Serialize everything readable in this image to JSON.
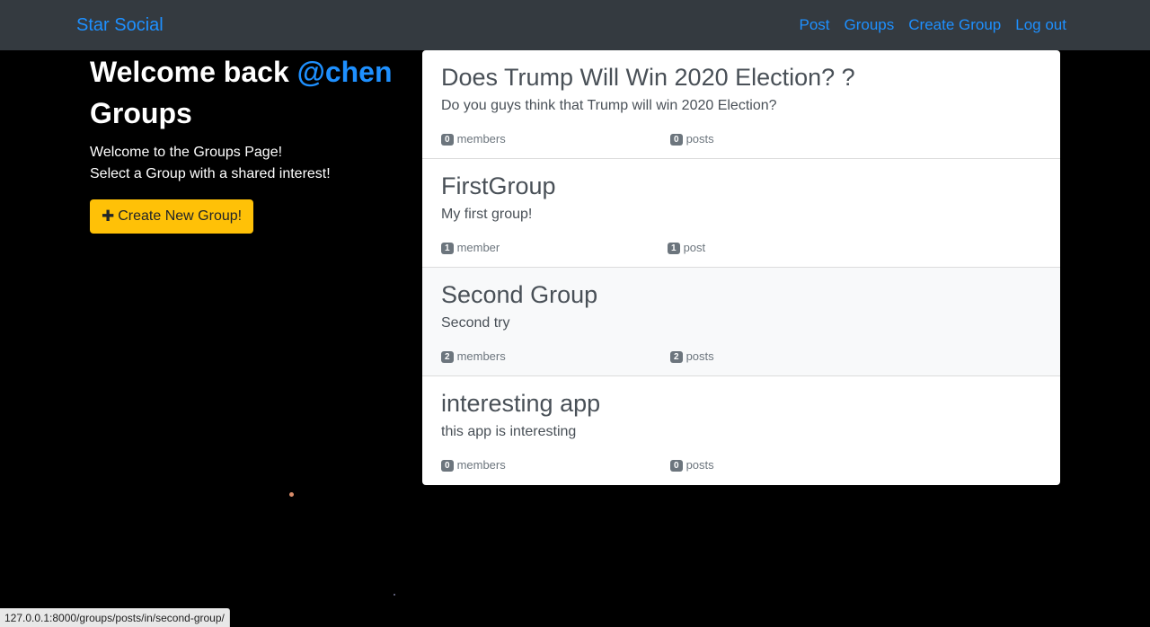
{
  "navbar": {
    "brand": "Star Social",
    "links": [
      "Post",
      "Groups",
      "Create Group",
      "Log out"
    ]
  },
  "sidebar": {
    "welcome_prefix": "Welcome back ",
    "username": "@chen",
    "heading": "Groups",
    "intro_line1": "Welcome to the Groups Page!",
    "intro_line2": "Select a Group with a shared interest!",
    "create_button": "Create New Group!",
    "create_icon": "plus-icon"
  },
  "groups": [
    {
      "title": "Does Trump Will Win 2020 Election? ?",
      "description": "Do you guys think that Trump will win 2020 Election?",
      "members_count": "0",
      "members_label": "members",
      "posts_count": "0",
      "posts_label": "posts"
    },
    {
      "title": "FirstGroup",
      "description": "My first group!",
      "members_count": "1",
      "members_label": "member",
      "posts_count": "1",
      "posts_label": "post"
    },
    {
      "title": "Second Group",
      "description": "Second try",
      "members_count": "2",
      "members_label": "members",
      "posts_count": "2",
      "posts_label": "posts"
    },
    {
      "title": "interesting app",
      "description": "this app is interesting",
      "members_count": "0",
      "members_label": "members",
      "posts_count": "0",
      "posts_label": "posts"
    }
  ],
  "status_bar": {
    "url": "127.0.0.1:8000/groups/posts/in/second-group/"
  },
  "colors": {
    "navbar_bg": "#343a40",
    "link": "#1e90ff",
    "button": "#ffc107",
    "page_bg": "#000000",
    "hover_row": "#f8f9fa"
  }
}
